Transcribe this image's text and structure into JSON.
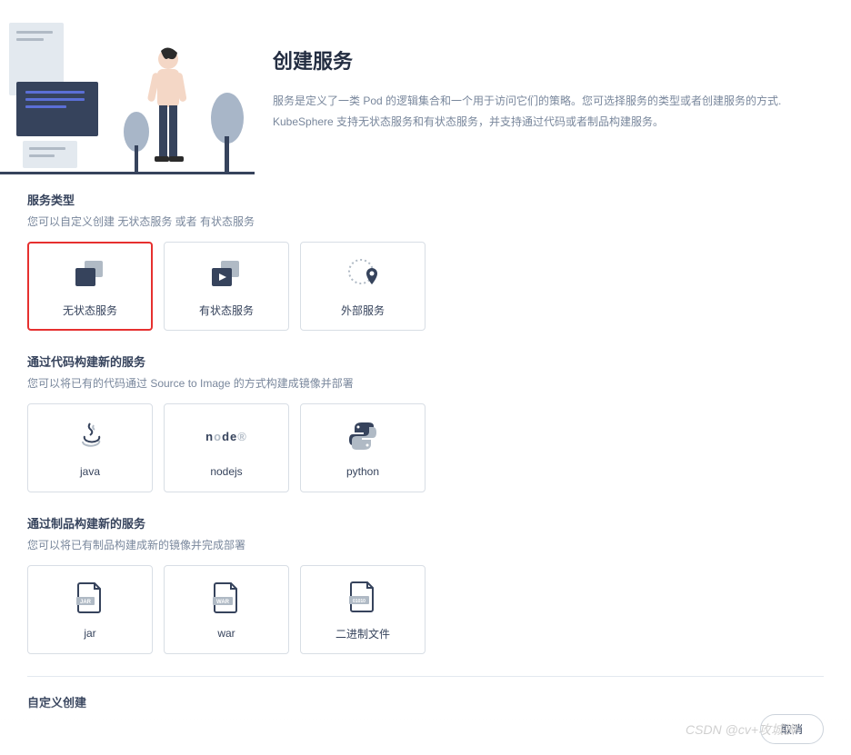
{
  "header": {
    "title": "创建服务",
    "desc1": "服务是定义了一类 Pod 的逻辑集合和一个用于访问它们的策略。您可选择服务的类型或者创建服务的方式.",
    "desc2": "KubeSphere 支持无状态服务和有状态服务，并支持通过代码或者制品构建服务。"
  },
  "sections": {
    "type": {
      "title": "服务类型",
      "desc": "您可以自定义创建 无状态服务 或者 有状态服务"
    },
    "code": {
      "title": "通过代码构建新的服务",
      "desc": "您可以将已有的代码通过 Source to Image 的方式构建成镜像并部署"
    },
    "artifact": {
      "title": "通过制品构建新的服务",
      "desc": "您可以将已有制品构建成新的镜像并完成部署"
    },
    "custom": {
      "title": "自定义创建"
    }
  },
  "cards": {
    "stateless": "无状态服务",
    "stateful": "有状态服务",
    "external": "外部服务",
    "java": "java",
    "nodejs": "nodejs",
    "python": "python",
    "jar": "jar",
    "war": "war",
    "binary": "二进制文件"
  },
  "footer": {
    "cancel": "取消"
  },
  "watermark": "CSDN @cv+攻城狮"
}
